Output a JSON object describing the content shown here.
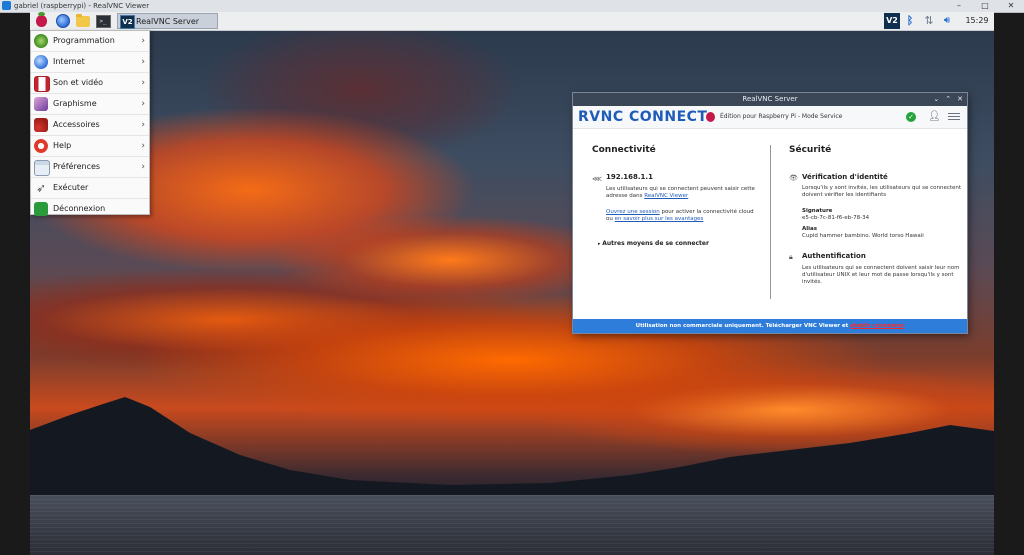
{
  "viewer": {
    "title": "gabriel (raspberrypi) - RealVNC Viewer",
    "controls": [
      "–",
      "□",
      "✕"
    ]
  },
  "taskbar": {
    "task_label": "RealVNC Server",
    "term_glyph": ">_",
    "clock": "15:29",
    "icons": [
      "raspberry-menu-icon",
      "web-browser-icon",
      "file-manager-icon",
      "terminal-icon",
      "vnc-tray-icon",
      "bluetooth-icon",
      "network-icon",
      "volume-icon"
    ]
  },
  "start_menu": {
    "items": [
      {
        "label": "Programmation",
        "submenu": true
      },
      {
        "label": "Internet",
        "submenu": true
      },
      {
        "label": "Son et vidéo",
        "submenu": true
      },
      {
        "label": "Graphisme",
        "submenu": true
      },
      {
        "label": "Accessoires",
        "submenu": true
      },
      {
        "label": "Help",
        "submenu": true
      },
      {
        "label": "Préférences",
        "submenu": true
      },
      {
        "label": "Exécuter",
        "submenu": false
      },
      {
        "label": "Déconnexion",
        "submenu": false
      }
    ],
    "arrow": "›"
  },
  "vnc": {
    "window_title": "RealVNC Server",
    "window_controls": [
      "⌄",
      "⌃",
      "✕"
    ],
    "logo": "RVNC CONNECT",
    "edition": "Édition pour Raspberry Pi - Mode Service",
    "connectivity": {
      "title": "Connectivité",
      "ip": "192.168.1.1",
      "p1_text": "Les utilisateurs qui se connectent peuvent saisir cette adresse dans ",
      "p1_link": "RealVNC Viewer",
      "p2_link1": "Ouvrez une session",
      "p2_text": " pour activer la connectivité cloud ou ",
      "p2_link2": "en savoir plus sur les avantages",
      "other_means": "Autres moyens de se connecter"
    },
    "security": {
      "title": "Sécurité",
      "identity_title": "Vérification d'identité",
      "identity_text": "Lorsqu'ils y sont invités, les utilisateurs qui se connectent doivent vérifier les identifiants",
      "signature_label": "Signature",
      "signature_value": "e5-cb-7c-81-f6-eb-78-34",
      "alias_label": "Alias",
      "alias_value": "Cupid hammer bambino. World torso Hawaii",
      "auth_title": "Authentification",
      "auth_text": "Les utilisateurs qui se connectent doivent saisir leur nom d'utilisateur UNIX et leur mot de passe lorsqu'ils y sont invités."
    },
    "footer_text": "Utilisation non commerciale uniquement. Télécharger VNC Viewer et ",
    "footer_link": "établir connexion"
  }
}
